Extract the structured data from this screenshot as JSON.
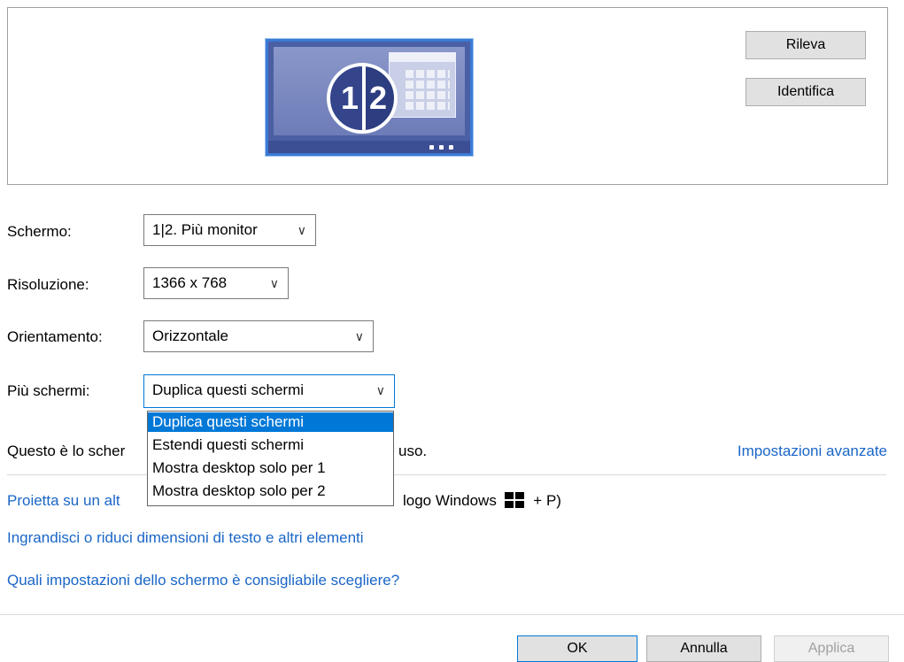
{
  "preview": {
    "monitor_number_left": "1",
    "monitor_number_right": "2",
    "detect_button": "Rileva",
    "identify_button": "Identifica"
  },
  "fields": {
    "display_label": "Schermo:",
    "display_value": "1|2. Più monitor",
    "resolution_label": "Risoluzione:",
    "resolution_value": "1366 x 768",
    "orientation_label": "Orientamento:",
    "orientation_value": "Orizzontale",
    "multiple_label": "Più schermi:",
    "multiple_value": "Duplica questi schermi"
  },
  "dropdown": {
    "options": [
      "Duplica questi schermi",
      "Estendi questi schermi",
      "Mostra desktop solo per 1",
      "Mostra desktop solo per 2"
    ],
    "selected_index": 0
  },
  "info": {
    "main_display_prefix": "Questo è lo scher",
    "main_display_suffix": "uso.",
    "advanced_link": "Impostazioni avanzate"
  },
  "links": {
    "project_prefix": "Proietta su un alt",
    "project_suffix": "logo Windows",
    "project_key": "+ P)",
    "text_size": "Ingrandisci o riduci dimensioni di testo e altri elementi",
    "which_settings": "Quali impostazioni dello schermo è consigliabile scegliere?"
  },
  "footer": {
    "ok": "OK",
    "cancel": "Annulla",
    "apply": "Applica"
  },
  "colors": {
    "link": "#1a66c6",
    "selection": "#0078d7",
    "monitor": "#4b5fa4"
  }
}
